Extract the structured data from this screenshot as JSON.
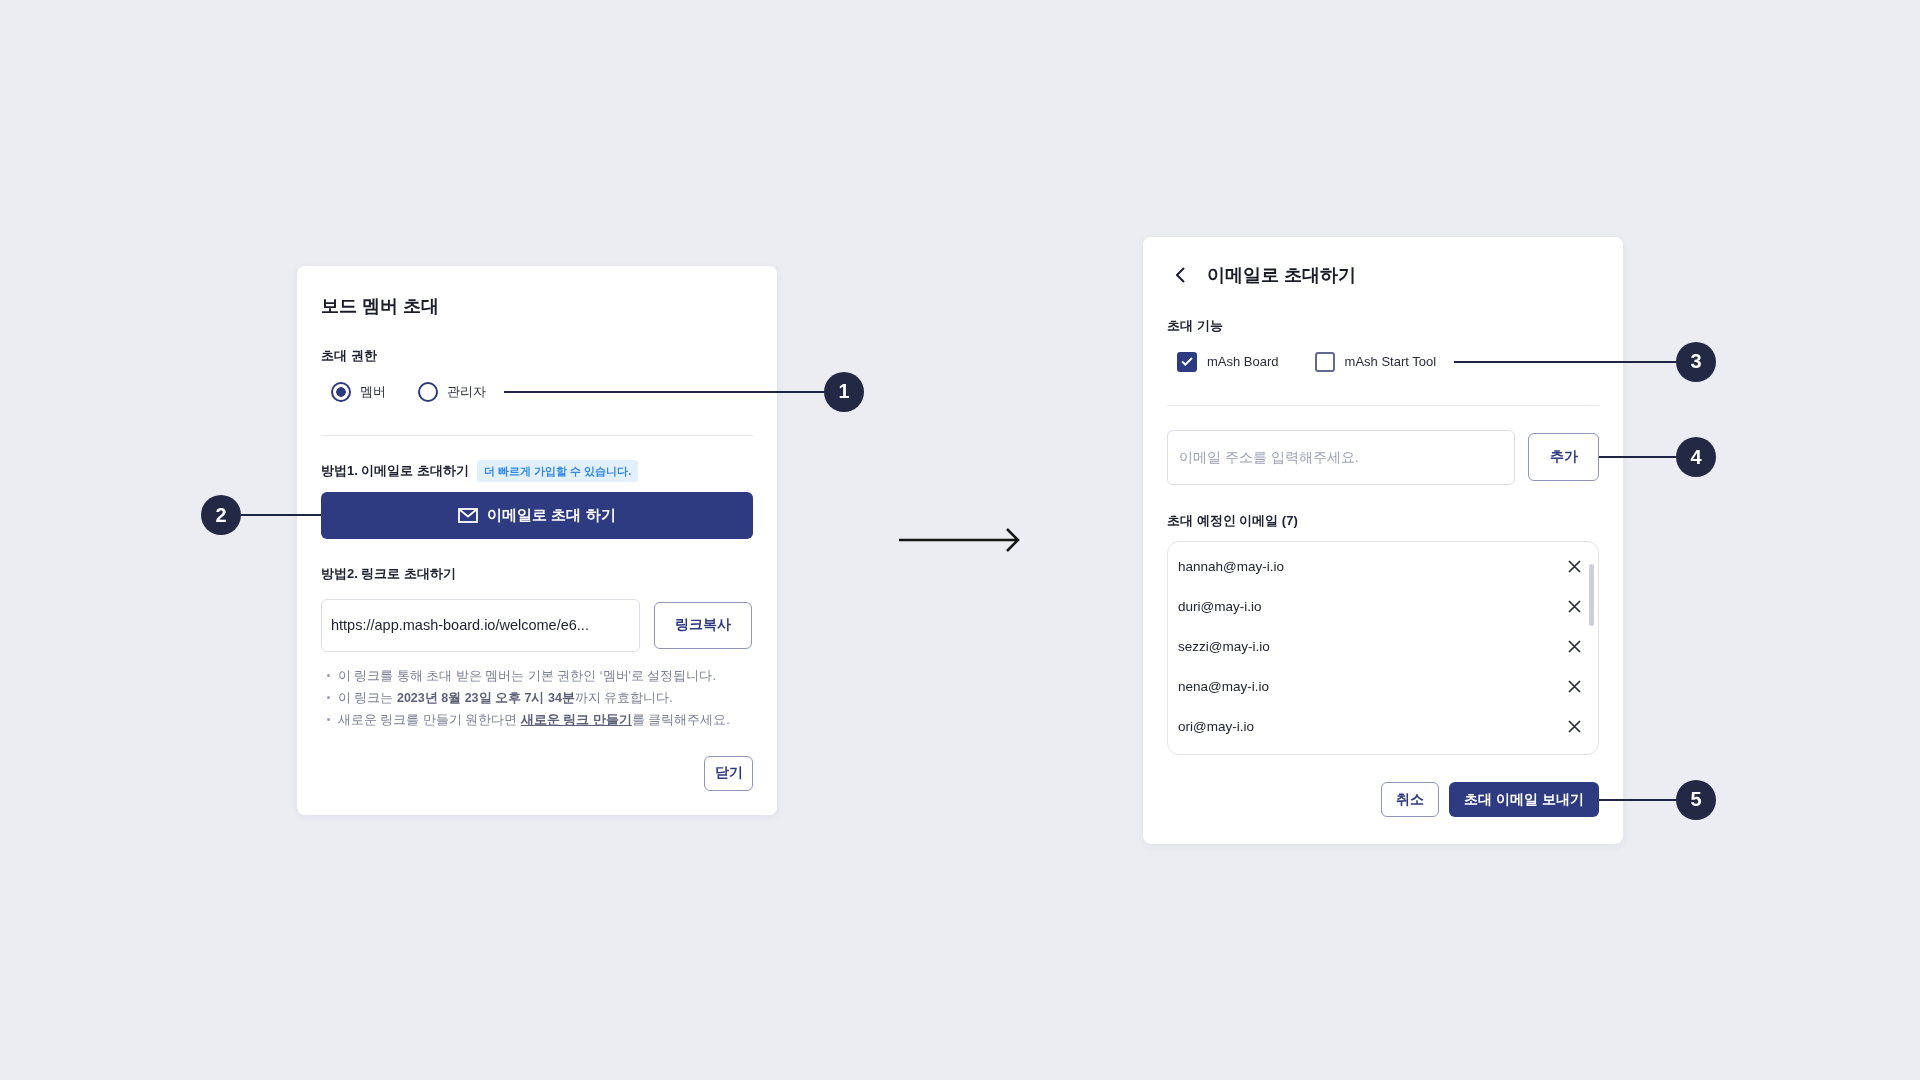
{
  "invite_dialog": {
    "title": "보드 멤버 초대",
    "role_section": {
      "label": "초대 권한",
      "options": [
        {
          "label": "멤버",
          "selected": true
        },
        {
          "label": "관리자",
          "selected": false
        }
      ],
      "callout": "1"
    },
    "email_method": {
      "label": "방법1. 이메일로 초대하기",
      "badge": "더 빠르게 가입할 수 있습니다.",
      "button": "이메일로 초대 하기",
      "callout": "2"
    },
    "link_method": {
      "label": "방법2. 링크로 초대하기",
      "url": "https://app.mash-board.io/welcome/e6...",
      "copy_button": "링크복사",
      "notes": [
        {
          "text": "이 링크를 통해 초대 받은 멤버는 기본 권한인 ‘멤버'로 설정됩니다."
        },
        {
          "text": "이 링크는 **2023년 8월 23일 오후 7시 34분**까지 유효합니다."
        },
        {
          "text": "새로운 링크를 만들기 원한다면 ",
          "link": "새로운 링크 만들기",
          "text_after": "를 클릭해주세요."
        }
      ]
    },
    "close_button": "닫기"
  },
  "email_dialog": {
    "title": "이메일로 초대하기",
    "feature_section": {
      "label": "초대 기능",
      "options": [
        {
          "label": "mAsh Board",
          "checked": true
        },
        {
          "label": "mAsh Start Tool",
          "checked": false
        }
      ],
      "callout": "3"
    },
    "email_input": {
      "placeholder": "이메일 주소를 입력해주세요.",
      "add_button": "추가",
      "callout": "4"
    },
    "list_label": "초대 예정인 이메일 (7)",
    "emails": [
      "hannah@may-i.io",
      "duri@may-i.io",
      "sezzi@may-i.io",
      "nena@may-i.io",
      "ori@may-i.io"
    ],
    "footer": {
      "buttons": [
        {
          "label": "취소",
          "kind": "secondary"
        },
        {
          "label": "초대 이메일 보내기",
          "kind": "primary"
        }
      ],
      "callout": "5"
    }
  }
}
